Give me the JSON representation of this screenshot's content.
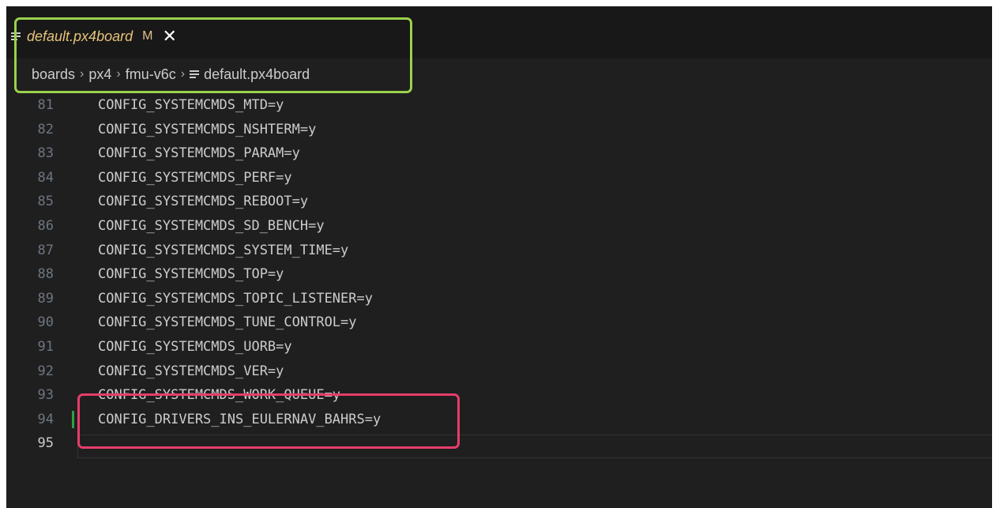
{
  "tab": {
    "filename": "default.px4board",
    "modified": "M",
    "close": "✕"
  },
  "breadcrumb": [
    {
      "label": "boards"
    },
    {
      "label": "px4"
    },
    {
      "label": "fmu-v6c"
    },
    {
      "label": "default.px4board"
    }
  ],
  "breadcrumb_sep": "›",
  "code_lines": [
    {
      "num": "81",
      "text": "CONFIG_SYSTEMCMDS_MTD=y"
    },
    {
      "num": "82",
      "text": "CONFIG_SYSTEMCMDS_NSHTERM=y"
    },
    {
      "num": "83",
      "text": "CONFIG_SYSTEMCMDS_PARAM=y"
    },
    {
      "num": "84",
      "text": "CONFIG_SYSTEMCMDS_PERF=y"
    },
    {
      "num": "85",
      "text": "CONFIG_SYSTEMCMDS_REBOOT=y"
    },
    {
      "num": "86",
      "text": "CONFIG_SYSTEMCMDS_SD_BENCH=y"
    },
    {
      "num": "87",
      "text": "CONFIG_SYSTEMCMDS_SYSTEM_TIME=y"
    },
    {
      "num": "88",
      "text": "CONFIG_SYSTEMCMDS_TOP=y"
    },
    {
      "num": "89",
      "text": "CONFIG_SYSTEMCMDS_TOPIC_LISTENER=y"
    },
    {
      "num": "90",
      "text": "CONFIG_SYSTEMCMDS_TUNE_CONTROL=y"
    },
    {
      "num": "91",
      "text": "CONFIG_SYSTEMCMDS_UORB=y"
    },
    {
      "num": "92",
      "text": "CONFIG_SYSTEMCMDS_VER=y"
    },
    {
      "num": "93",
      "text": "CONFIG_SYSTEMCMDS_WORK_QUEUE=y"
    },
    {
      "num": "94",
      "text": "CONFIG_DRIVERS_INS_EULERNAV_BAHRS=y"
    },
    {
      "num": "95",
      "text": ""
    }
  ],
  "colors": {
    "editor_bg": "#1f1f1f",
    "tab_text": "#e6c27a",
    "highlight_green": "#9bd14d",
    "highlight_red": "#e63d6b",
    "added_line_marker": "#2ea043"
  }
}
